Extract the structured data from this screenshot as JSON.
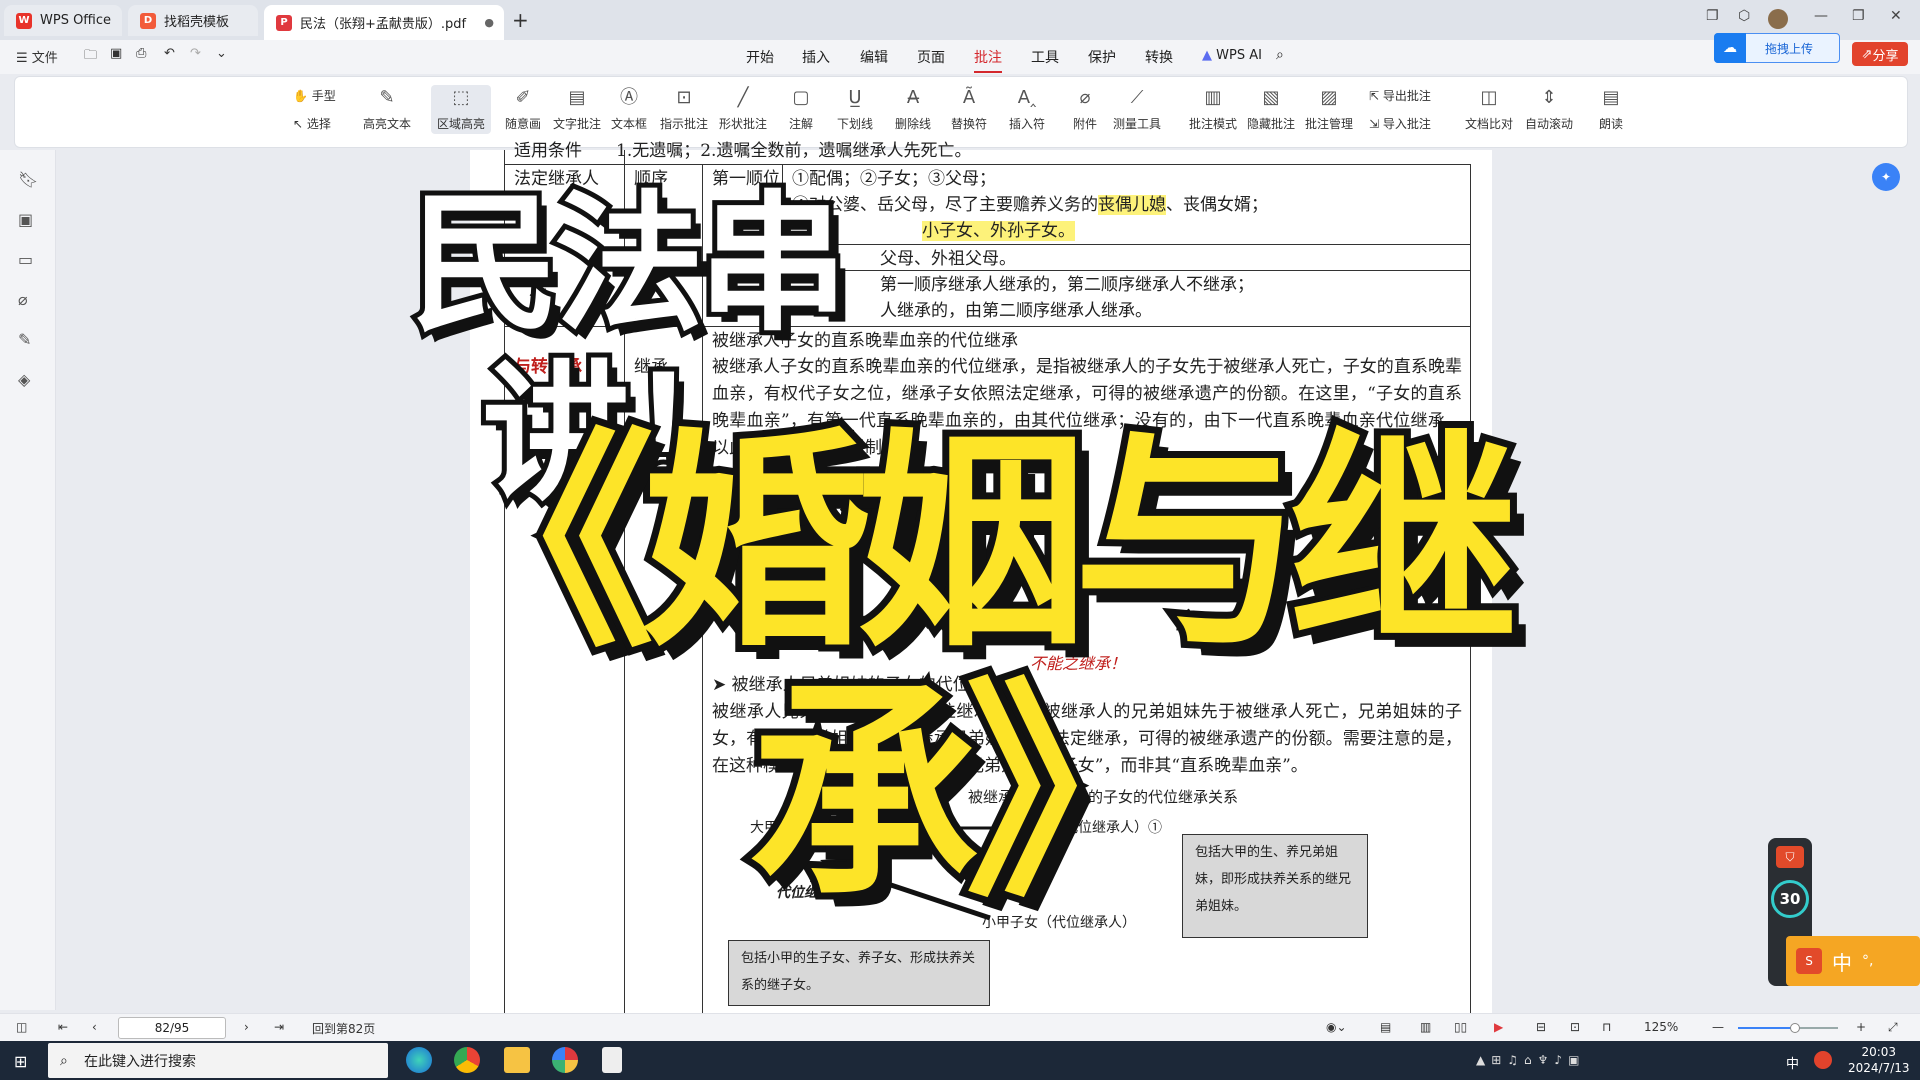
{
  "tabs": [
    {
      "label": "WPS Office",
      "icon": "wps-logo-icon"
    },
    {
      "label": "找稻壳模板",
      "icon": "docer-icon"
    },
    {
      "label": "民法（张翔+孟献贵版）.pdf",
      "icon": "pdf-icon"
    }
  ],
  "quickbar": {
    "file_label": "文件"
  },
  "menu": [
    "开始",
    "插入",
    "编辑",
    "页面",
    "批注",
    "工具",
    "保护",
    "转换",
    "WPS AI"
  ],
  "menu_active": "批注",
  "upload_label": "拖拽上传",
  "share_label": "分享",
  "ribbon": {
    "hand": "手型",
    "select": "选择",
    "items": [
      "高亮文本",
      "区域高亮",
      "随意画",
      "文字批注",
      "文本框",
      "指示批注",
      "形状批注",
      "注解",
      "下划线",
      "删除线",
      "替换符",
      "插入符",
      "附件",
      "测量工具",
      "批注模式",
      "隐藏批注",
      "批注管理",
      "文档比对",
      "自动滚动",
      "朗读"
    ],
    "export": "导出批注",
    "import": "导入批注"
  },
  "doc": {
    "row0": "适用条件　　1.无遗嘱；2.遗嘱全数前，遗嘱继承人先死亡。",
    "cell_legal": "法定继承人",
    "cell_order": "顺序",
    "cell_first": "第一顺位",
    "item1": "①配偶；②子女；③父母；",
    "item2a": "④对公婆、岳父母，尽了主要赡养义务的",
    "item2hl": "丧偶儿媳",
    "item2b": "、丧偶女婿；",
    "item3hl": "小子女、外孙子女。",
    "item4": "父母、外祖父母。",
    "item5": "第一顺序继承人继承的，第二顺序继承人不继承；",
    "item6": "人继承的，由第二顺序继承人继承。",
    "red_label": "与转继承",
    "col_inherit": "继承",
    "sub1": "被继承人子女的直系晚辈血亲的代位继承",
    "p1": "被继承人子女的直系晚辈血亲的代位继承，是指被继承人的子女先于被继承人死亡，子女的直系晚辈血亲，有权代子女之位，继承子女依照法定继承，可得的被继承遗产的份额。在这里，“子女的直系晚辈血亲”，有第一代直系晚辈血亲的，由其代位继承；没有的，由下一代直系晚辈血亲代位继承，以此类推不受辈数限制。",
    "sub2": "被继承人兄弟姐妹的子女的代位继承",
    "p2": "被继承人兄弟姐妹的子女的代位继承，是指被继承人的兄弟姐妹先于被继承人死亡，兄弟姐妹的子女，有权代兄弟姐妹之位，继承兄弟姐妹依照法定继承，可得的被继承遗产的份额。需要注意的是，在这种模式下，代位继承人仅限于兄弟姐妹的“子女”，而非其“直系晚辈血亲”。",
    "fig_title": "被继承人兄弟姐妹的子女的代位继承关系",
    "node_big": "大甲（被继承人）②",
    "node_small": "小甲（被代位继承人）①",
    "node_child": "小甲子女（代位继承人）",
    "edge_label": "代位继承",
    "box_right": "包括大甲的生、养兄弟姐妹，即形成扶养关系的继兄弟姐妹。",
    "box_bottom": "包括小甲的生子女、养子女、形成扶养关系的继子女。",
    "handwriting": "不能之继承！",
    "partial_left": "直系晚辈血亲"
  },
  "overlay": {
    "line1": "民法串讲！",
    "line2": "《婚姻与继承》"
  },
  "status": {
    "page": "82/95",
    "back": "回到第82页",
    "zoom": "125%"
  },
  "taskbar": {
    "search_placeholder": "在此键入进行搜索",
    "time": "20:03",
    "date": "2024/7/13",
    "ime": "中"
  },
  "float": {
    "count": "30",
    "ime_label": "中"
  }
}
